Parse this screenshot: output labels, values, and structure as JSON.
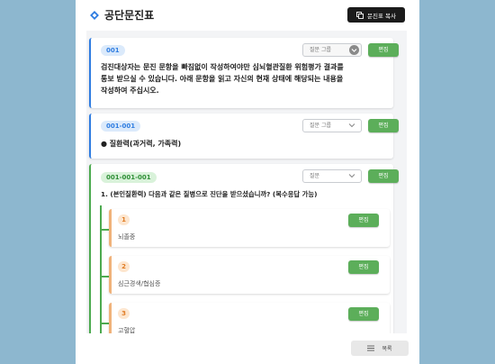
{
  "header": {
    "title": "공단문진표",
    "copy_label": "문진표 복사",
    "accent": "#2f7de1"
  },
  "cards": [
    {
      "code": "001",
      "select": "질문 그룹",
      "edit": "편집",
      "text_lines": [
        "검진대상자는 문진 문항을 빠짐없이 작성하여야만 심뇌혈관질환 위험평가 결과를",
        "통보 받으실 수 있습니다. 아래 문항을 읽고 자신의 현재 상태에 해당되는 내용을",
        "작성하여 주십시오."
      ]
    },
    {
      "code": "001-001",
      "select": "질문 그룹",
      "edit": "편집",
      "text": "● 질환력(과거력, 가족력)"
    },
    {
      "code": "001-001-001",
      "select": "질문",
      "edit": "편집",
      "text": "1. (본인질환력) 다음과 같은 질병으로 진단을 받으셨습니까? (복수응답 가능)"
    }
  ],
  "options": [
    {
      "num": "1",
      "text": "뇌졸중",
      "edit": "편집"
    },
    {
      "num": "2",
      "text": "심근경색/협심증",
      "edit": "편집"
    },
    {
      "num": "3",
      "text": "고혈압",
      "edit": "편집"
    }
  ],
  "footer": {
    "list_label": "목록"
  }
}
